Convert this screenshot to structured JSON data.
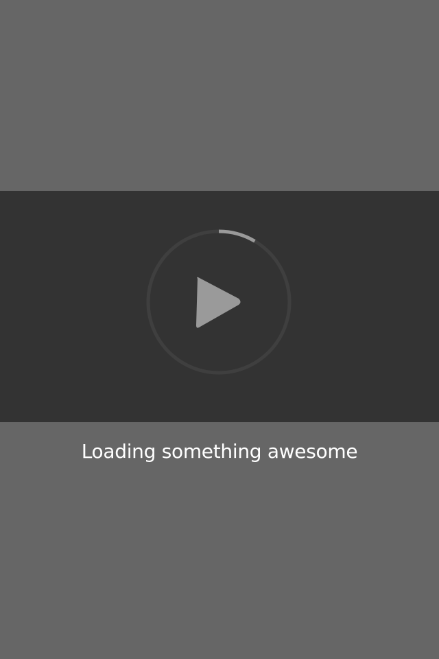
{
  "loading": {
    "message": "Loading something awesome",
    "progress": 0.085
  },
  "icons": {
    "play": "play-icon",
    "progress": "progress-ring"
  },
  "colors": {
    "page_background": "#666666",
    "band_background": "#333333",
    "ring_track": "#3f3f3f",
    "ring_progress": "#9a9a9a",
    "play_icon": "#9a9a9a",
    "text": "#ffffff"
  }
}
